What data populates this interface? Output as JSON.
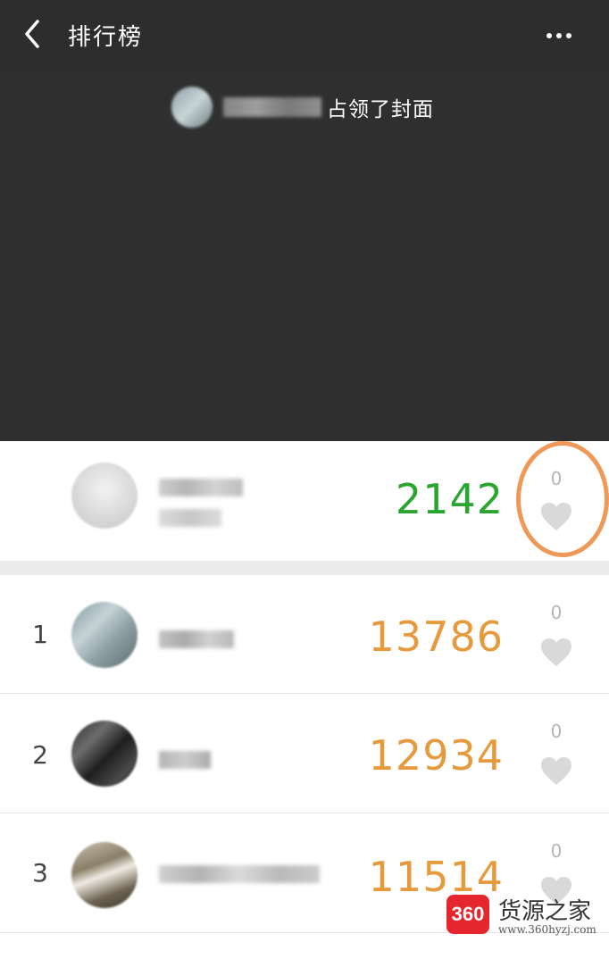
{
  "header": {
    "title": "排行榜"
  },
  "cover": {
    "text": "占领了封面"
  },
  "self_row": {
    "rank": "",
    "steps": "2142",
    "likes": "0"
  },
  "ranking": [
    {
      "rank": "1",
      "steps": "13786",
      "likes": "0"
    },
    {
      "rank": "2",
      "steps": "12934",
      "likes": "0"
    },
    {
      "rank": "3",
      "steps": "11514",
      "likes": "0"
    }
  ],
  "colors": {
    "self_steps": "#2aa52f",
    "rank_steps": "#e59b3d",
    "highlight": "#ee9957",
    "heart": "#d9d9d9"
  },
  "watermark": {
    "badge": "360",
    "name": "货源之家",
    "url": "www.360hyzj.com"
  }
}
